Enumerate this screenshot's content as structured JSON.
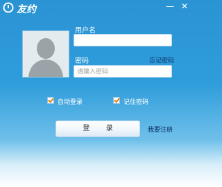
{
  "window": {
    "title": "友约",
    "logo_icon": "circle-arrow-logo-icon",
    "minimize_symbol": "—",
    "close_symbol": "✕"
  },
  "login": {
    "username_label": "用户名",
    "username_value": "",
    "password_label": "密码",
    "password_placeholder": "请输入密码",
    "forgot_password_link": "忘记密码",
    "auto_login_label": "自动登录",
    "auto_login_checked": true,
    "remember_password_label": "记住密码",
    "remember_password_checked": true,
    "login_button_label": "登 录",
    "register_link": "我要注册"
  },
  "colors": {
    "accent": "#2f9ddb",
    "checkmark": "#e87f13",
    "link": "#0d2f66"
  }
}
